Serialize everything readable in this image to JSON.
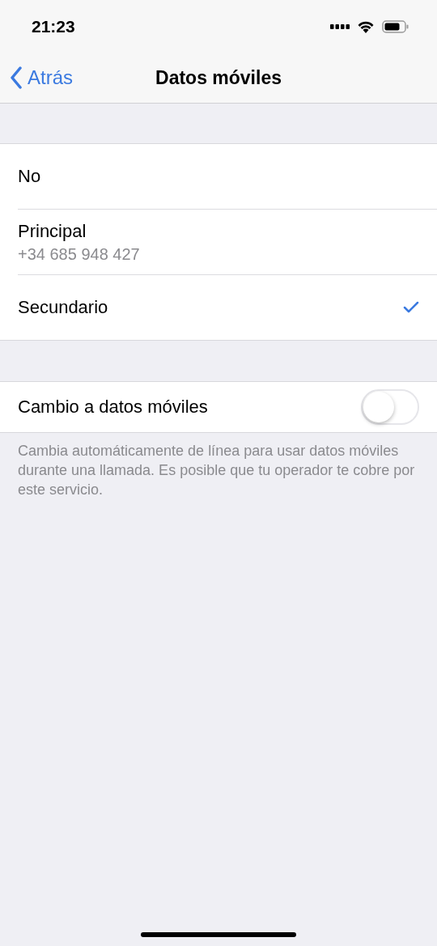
{
  "status_bar": {
    "time": "21:23"
  },
  "nav": {
    "back": "Atrás",
    "title": "Datos móviles"
  },
  "options": [
    {
      "label": "No",
      "selected": false
    },
    {
      "label": "Principal",
      "detail": "+34 685 948 427",
      "selected": false
    },
    {
      "label": "Secundario",
      "selected": true
    }
  ],
  "switch_row": {
    "label": "Cambio a datos móviles",
    "on": false
  },
  "footer": "Cambia automáticamente de línea para usar datos móviles durante una llamada. Es posible que tu operador te cobre por este servicio."
}
